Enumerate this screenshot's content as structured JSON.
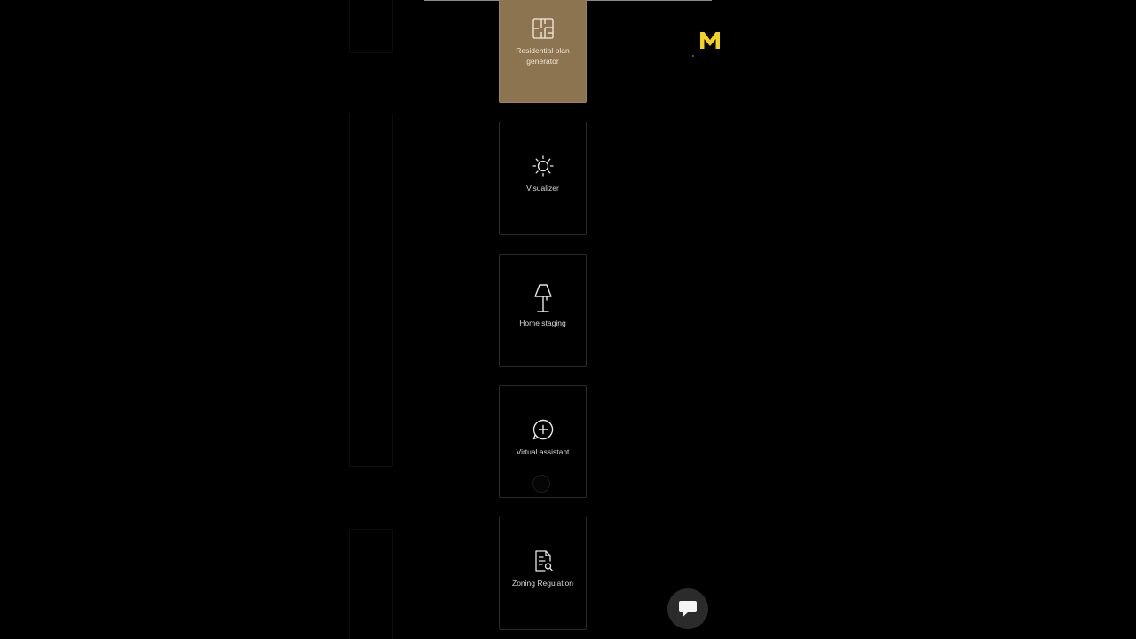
{
  "brand": {
    "logo_letter": "M",
    "logo_color": "#f2d21b"
  },
  "tools": [
    {
      "label": "Residential plan generator",
      "icon": "floor-plan-icon",
      "active": true
    },
    {
      "label": "Visualizer",
      "icon": "sun-icon",
      "active": false
    },
    {
      "label": "Home staging",
      "icon": "lamp-icon",
      "active": false
    },
    {
      "label": "Virtual assistant",
      "icon": "chat-plus-icon",
      "active": false
    },
    {
      "label": "Zoning Regulation",
      "icon": "document-search-icon",
      "active": false
    }
  ],
  "chat_widget": {
    "icon": "chat-bubble-icon"
  },
  "colors": {
    "background": "#000000",
    "active_card": "#8c7450",
    "card_border": "#2a2a2a",
    "text": "#d8d8d8"
  }
}
